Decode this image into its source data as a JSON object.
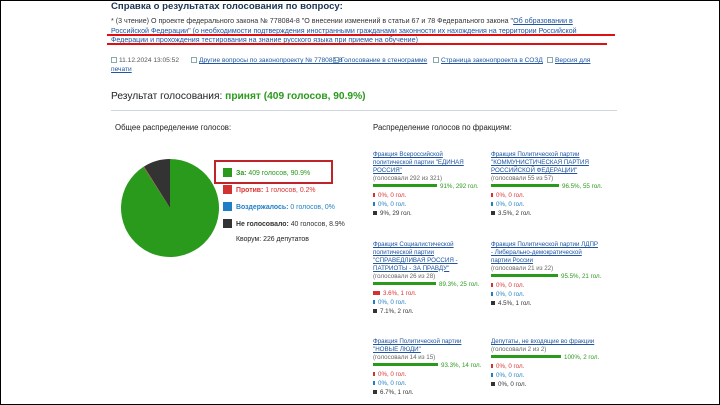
{
  "page": {
    "title": "Справка о результатах голосования по вопросу:",
    "reading_prefix": "* (3 чтение) О проекте федерального закона № 778084-8 \"О внесении изменений в статьи 67 и 78 Федерального закона \"",
    "reading_link": "Об образовании в Российской Федерации\" (о необходимости подтверждения иностранными гражданами законности их нахождения на территории Российской Федерации и прохождения тестирования на знание русского языка при приеме на обучение)",
    "meta": {
      "date": "11.12.2024 13:05:52",
      "other_questions": "Другие вопросы по законопроекту № 778084-8",
      "transcript": "Голосование в стенограмме",
      "sozd_page": "Страница законопроекта в СОЗД",
      "print_1": "Версия для",
      "print_2": "печати"
    },
    "result_label": "Результат голосования:",
    "result_value": "принят (409 голосов, 90.9%)",
    "overall_title": "Общее распределение голосов:",
    "factions_title": "Распределение голосов по фракциям:"
  },
  "colors": {
    "for": "#2a9a1c",
    "against": "#d33232",
    "abstain": "#1f7fc4",
    "absent": "#333333",
    "highlight": "#c0242b"
  },
  "overall": {
    "for_label": "За:",
    "for_value": "409 голосов, 90.9%",
    "for_pct": 90.9,
    "against_label": "Против:",
    "against_value": "1 голосов, 0.2%",
    "against_pct": 0.2,
    "abstain_label": "Воздержалось:",
    "abstain_value": "0 голосов, 0%",
    "abstain_pct": 0,
    "absent_label": "Не голосовало:",
    "absent_value": "40 голосов, 8.9%",
    "absent_pct": 8.9,
    "quorum": "Кворум: 226 депутатов"
  },
  "factions": [
    {
      "name": "Фракция Всероссийской политической партии \"ЕДИНАЯ РОССИЯ\"",
      "voted": "(голосовали 292 из 321)",
      "for": "91%, 292 гол.",
      "for_pct": 91,
      "against": "0%, 0 гол.",
      "against_pct": 0,
      "abstain": "0%, 0 гол.",
      "abstain_pct": 0,
      "absent": "9%, 29 гол.",
      "absent_pct": 9
    },
    {
      "name": "Фракция Политической партии \"КОММУНИСТИЧЕСКАЯ ПАРТИЯ РОССИЙСКОЙ ФЕДЕРАЦИИ\"",
      "voted": "(голосовали 55 из 57)",
      "for": "96.5%, 55 гол.",
      "for_pct": 96.5,
      "against": "0%, 0 гол.",
      "against_pct": 0,
      "abstain": "0%, 0 гол.",
      "abstain_pct": 0,
      "absent": "3.5%, 2 гол.",
      "absent_pct": 3.5
    },
    {
      "name": "Фракция Социалистической политической партии \"СПРАВЕДЛИВАЯ РОССИЯ - ПАТРИОТЫ - ЗА ПРАВДУ\"",
      "voted": "(голосовали 26 из 28)",
      "for": "89.3%, 25 гол.",
      "for_pct": 89.3,
      "against": "3.6%, 1 гол.",
      "against_pct": 3.6,
      "abstain": "0%, 0 гол.",
      "abstain_pct": 0,
      "absent": "7.1%, 2 гол.",
      "absent_pct": 7.1
    },
    {
      "name": "Фракция Политической партии ЛДПР - Либерально-демократической партии России",
      "voted": "(голосовали 21 из 22)",
      "for": "95.5%, 21 гол.",
      "for_pct": 95.5,
      "against": "0%, 0 гол.",
      "against_pct": 0,
      "abstain": "0%, 0 гол.",
      "abstain_pct": 0,
      "absent": "4.5%, 1 гол.",
      "absent_pct": 4.5
    },
    {
      "name": "Фракция Политической партии \"НОВЫЕ ЛЮДИ\"",
      "voted": "(голосовали 14 из 15)",
      "for": "93.3%, 14 гол.",
      "for_pct": 93.3,
      "against": "0%, 0 гол.",
      "against_pct": 0,
      "abstain": "0%, 0 гол.",
      "abstain_pct": 0,
      "absent": "6.7%, 1 гол.",
      "absent_pct": 6.7
    },
    {
      "name": "Депутаты, не входящие во фракции",
      "voted": "(голосовали 2 из 2)",
      "for": "100%, 2 гол.",
      "for_pct": 100,
      "against": "0%, 0 гол.",
      "against_pct": 0,
      "abstain": "0%, 0 гол.",
      "abstain_pct": 0,
      "absent": "0%, 0 гол.",
      "absent_pct": 0
    }
  ]
}
